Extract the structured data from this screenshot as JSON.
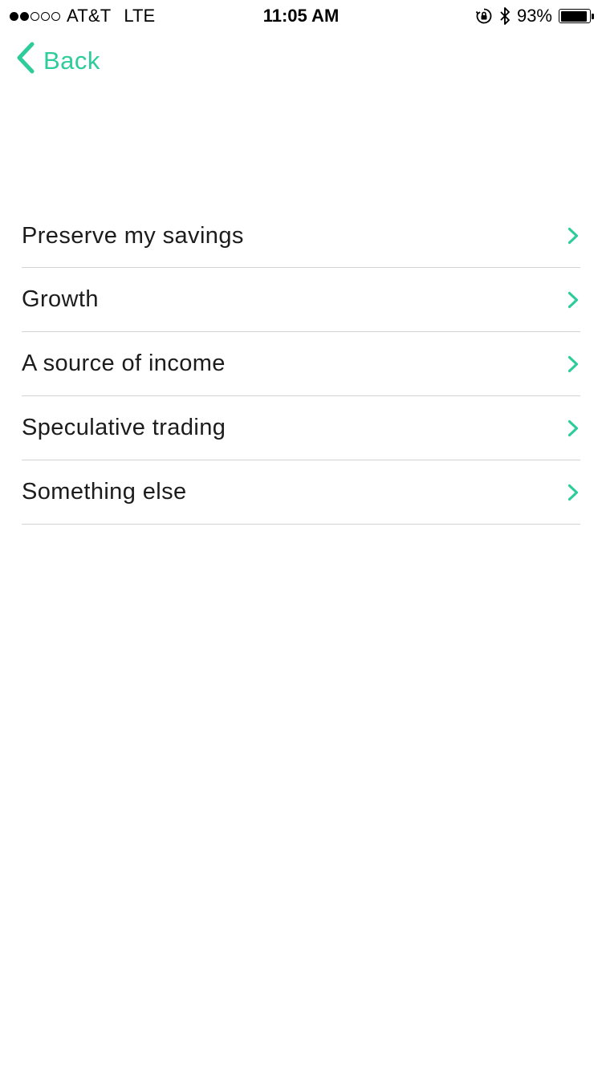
{
  "status_bar": {
    "signal_filled": 2,
    "signal_total": 5,
    "carrier": "AT&T",
    "network": "LTE",
    "time": "11:05 AM",
    "battery_percent_label": "93%",
    "battery_level": 0.93
  },
  "nav": {
    "back_label": "Back"
  },
  "question": {
    "title": ""
  },
  "options": [
    {
      "label": "Preserve my savings"
    },
    {
      "label": "Growth"
    },
    {
      "label": "A source of income"
    },
    {
      "label": "Speculative trading"
    },
    {
      "label": "Something else"
    }
  ],
  "colors": {
    "accent": "#2ecc9a",
    "divider": "#d3d3d3",
    "text": "#1c1c1c"
  },
  "icons": {
    "back": "chevron-left-icon",
    "row": "chevron-right-icon",
    "rotation_lock": "rotation-lock-icon",
    "bluetooth": "bluetooth-icon",
    "battery": "battery-icon"
  }
}
